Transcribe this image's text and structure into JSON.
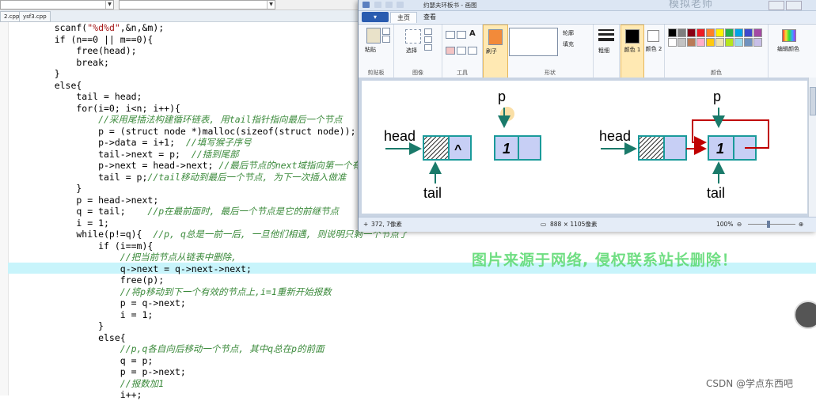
{
  "ide": {
    "tabs": [
      "2.cpp",
      "ysf3.cpp"
    ],
    "code_lines": [
      [
        {
          "t": "    scanf(",
          "c": "code"
        },
        {
          "t": "\"%d%d\"",
          "c": "str"
        },
        {
          "t": ",&n,&m);",
          "c": "code"
        }
      ],
      [
        {
          "t": "    if (n==0 || m==0){",
          "c": "code"
        }
      ],
      [
        {
          "t": "        free(head);",
          "c": "code"
        }
      ],
      [
        {
          "t": "        break;",
          "c": "code"
        }
      ],
      [
        {
          "t": "    }",
          "c": "code"
        }
      ],
      [
        {
          "t": "    else{",
          "c": "code"
        }
      ],
      [
        {
          "t": "        tail = head;",
          "c": "code"
        }
      ],
      [
        {
          "t": "        for(i=0; i<n; i++){",
          "c": "code"
        }
      ],
      [
        {
          "t": "            //采用尾插法构建循环链表, 用tail指针指向最后一个节点",
          "c": "cm"
        }
      ],
      [
        {
          "t": "            p = (struct node *)malloc(sizeof(struct node));",
          "c": "code"
        }
      ],
      [
        {
          "t": "            p->data = i+1;  ",
          "c": "code"
        },
        {
          "t": "//填写猴子序号",
          "c": "cm"
        }
      ],
      [
        {
          "t": "            tail->next = p;  ",
          "c": "code"
        },
        {
          "t": "//插到尾部",
          "c": "cm"
        }
      ],
      [
        {
          "t": "            p->next = head->next; ",
          "c": "code"
        },
        {
          "t": "//最后节点的next域指向第一个有",
          "c": "cm"
        }
      ],
      [
        {
          "t": "            tail = p;",
          "c": "code"
        },
        {
          "t": "//tail移动到最后一个节点, 为下一次插入做准",
          "c": "cm"
        }
      ],
      [
        {
          "t": "        }",
          "c": "code"
        }
      ],
      [
        {
          "t": "        p = head->next;",
          "c": "code"
        }
      ],
      [
        {
          "t": "        q = tail;    ",
          "c": "code"
        },
        {
          "t": "//p在最前面时, 最后一个节点是它的前继节点",
          "c": "cm"
        }
      ],
      [
        {
          "t": "        i = 1;",
          "c": "code"
        }
      ],
      [
        {
          "t": "        while(p!=q){  ",
          "c": "code"
        },
        {
          "t": "//p, q总是一前一后, 一旦他们相遇, 则说明只剩一个节点了",
          "c": "cm"
        }
      ],
      [
        {
          "t": "            if (i==m){",
          "c": "code"
        }
      ],
      [
        {
          "t": "                //把当前节点从链表中删除,",
          "c": "cm"
        }
      ],
      [
        {
          "t": "                q->next = q->next->next;",
          "c": "code"
        }
      ],
      [
        {
          "t": "                free(p);",
          "c": "code"
        }
      ],
      [
        {
          "t": "                //将p移动到下一个有效的节点上,i=1重新开始报数",
          "c": "cm"
        }
      ],
      [
        {
          "t": "                p = q->next;",
          "c": "code"
        }
      ],
      [
        {
          "t": "                i = 1;",
          "c": "code"
        }
      ],
      [
        {
          "t": "            }",
          "c": "code"
        }
      ],
      [
        {
          "t": "            else{",
          "c": "code"
        }
      ],
      [
        {
          "t": "                //p,q各自向后移动一个节点, 其中q总在p的前面",
          "c": "cm"
        }
      ],
      [
        {
          "t": "                q = p;",
          "c": "code"
        }
      ],
      [
        {
          "t": "                p = p->next;",
          "c": "code"
        }
      ],
      [
        {
          "t": "                //报数加1",
          "c": "cm"
        }
      ],
      [
        {
          "t": "                i++;",
          "c": "code"
        }
      ]
    ],
    "highlighted_line": 21
  },
  "paint": {
    "title": "约瑟夫环板书 - 画图",
    "brand": "模拟老师",
    "file_menu": "▾",
    "tabs": [
      "主页",
      "查看"
    ],
    "ribbon": {
      "paste": "粘贴",
      "select": "选择",
      "brush": "刷子",
      "outline": "轮廓",
      "fill": "填充",
      "size": "粗细",
      "color1": "颜色 1",
      "color2": "颜色 2",
      "edit_colors": "编辑颜色",
      "groups": [
        "剪贴板",
        "图像",
        "工具",
        "形状",
        "颜色"
      ]
    },
    "palette": [
      "#000000",
      "#7f7f7f",
      "#880015",
      "#ed1c24",
      "#ff7f27",
      "#fff200",
      "#22b14c",
      "#00a2e8",
      "#3f48cc",
      "#a349a4",
      "#ffffff",
      "#c3c3c3",
      "#b97a57",
      "#ffaec9",
      "#ffc90e",
      "#efe4b0",
      "#b5e61d",
      "#99d9ea",
      "#7092be",
      "#c8bfe7"
    ],
    "status": {
      "cursor": "372, 7像素",
      "size": "888 × 1105像素",
      "zoom": "100%"
    },
    "diagram": {
      "label_head": "head",
      "label_tail": "tail",
      "label_p": "p",
      "node_value": "1",
      "null_mark": "^",
      "node_fill": "#c7cff5",
      "node_stroke": "#1a9a9a",
      "arrow_color": "#1a7a6a",
      "link_color": "#c00000"
    }
  },
  "watermark": "图片来源于网络, 侵权联系站长删除！",
  "credit": "CSDN @学点东西吧"
}
